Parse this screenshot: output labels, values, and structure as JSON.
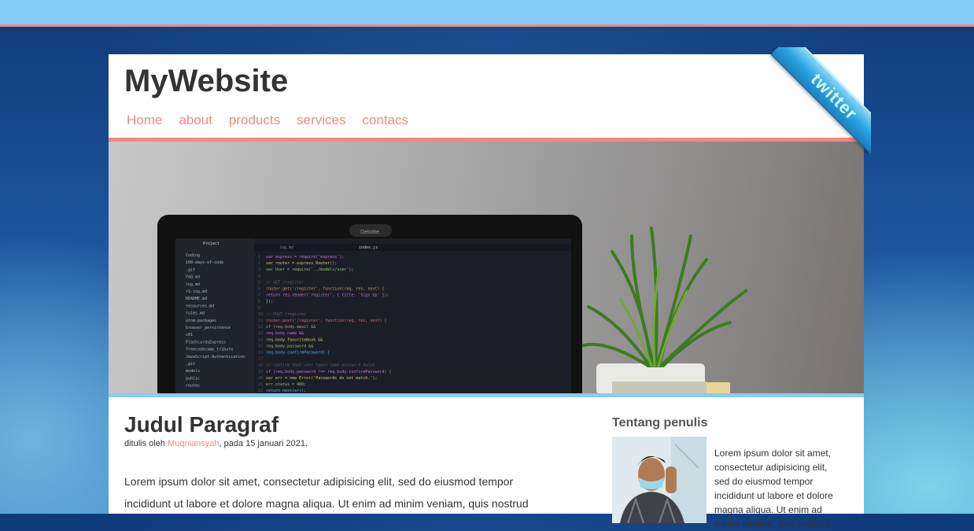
{
  "site": {
    "title": "MyWebsite"
  },
  "nav": {
    "items": [
      "Home",
      "about",
      "products",
      "services",
      "contacs"
    ]
  },
  "ribbon": {
    "label": "twitter"
  },
  "hero": {
    "laptop_brand": "Deloitte.",
    "panel_title": "Project",
    "tab_left": "log.md",
    "tab_right": "index.js",
    "file_tree": [
      "Coding",
      "100-days-of-code",
      ".git",
      "FAQ.md",
      "log.md",
      "r1-log.md",
      "README.md",
      "resources.md",
      "rules.md",
      "atom-packages",
      "browser_persistence",
      "c01",
      "FlashcardsExpress",
      "freecodecamp_tribute",
      "JavaScript-Authentication",
      ".git",
      "models",
      "public",
      "routes"
    ],
    "code_lines": [
      "var express = require('express');",
      "var router = express.Router();",
      "var User = require('../models/user');",
      "",
      "// GET /register",
      "router.get('/register', function(req, res, next) {",
      "  return res.render('register', { title: 'Sign Up' });",
      "});",
      "",
      "// POST /register",
      "router.post('/register', function(req, res, next) {",
      "  if (req.body.email &&",
      "    req.body.name &&",
      "    req.body.favoriteBook &&",
      "    req.body.password &&",
      "    req.body.confirmPassword) {",
      "",
      "      // confirm that user typed same password twice",
      "      if (req.body.password !== req.body.confirmPassword) {",
      "        var err = new Error('Passwords do not match.');",
      "        err.status = 400;",
      "        return next(err);",
      "      }"
    ]
  },
  "post": {
    "title": "Judul Paragraf",
    "meta_prefix": "ditulis oleh ",
    "author": "Muqniansyah",
    "meta_suffix": ", pada 15 januari 2021.",
    "body": "Lorem ipsum dolor sit amet, consectetur adipisicing elit, sed do eiusmod tempor incididunt ut labore et dolore magna aliqua. Ut enim ad minim veniam, quis nostrud"
  },
  "sidebar": {
    "title": "Tentang penulis",
    "bio": "Lorem ipsum dolor sit amet, consectetur adipisicing elit, sed do eiusmod tempor incididunt ut labore et dolore magna aliqua. Ut enim ad minim veniam, quis nostrud"
  },
  "colors": {
    "accent": "#f08a7f",
    "topbar": "#85cdf9",
    "ribbon": "#2aa7e3"
  }
}
